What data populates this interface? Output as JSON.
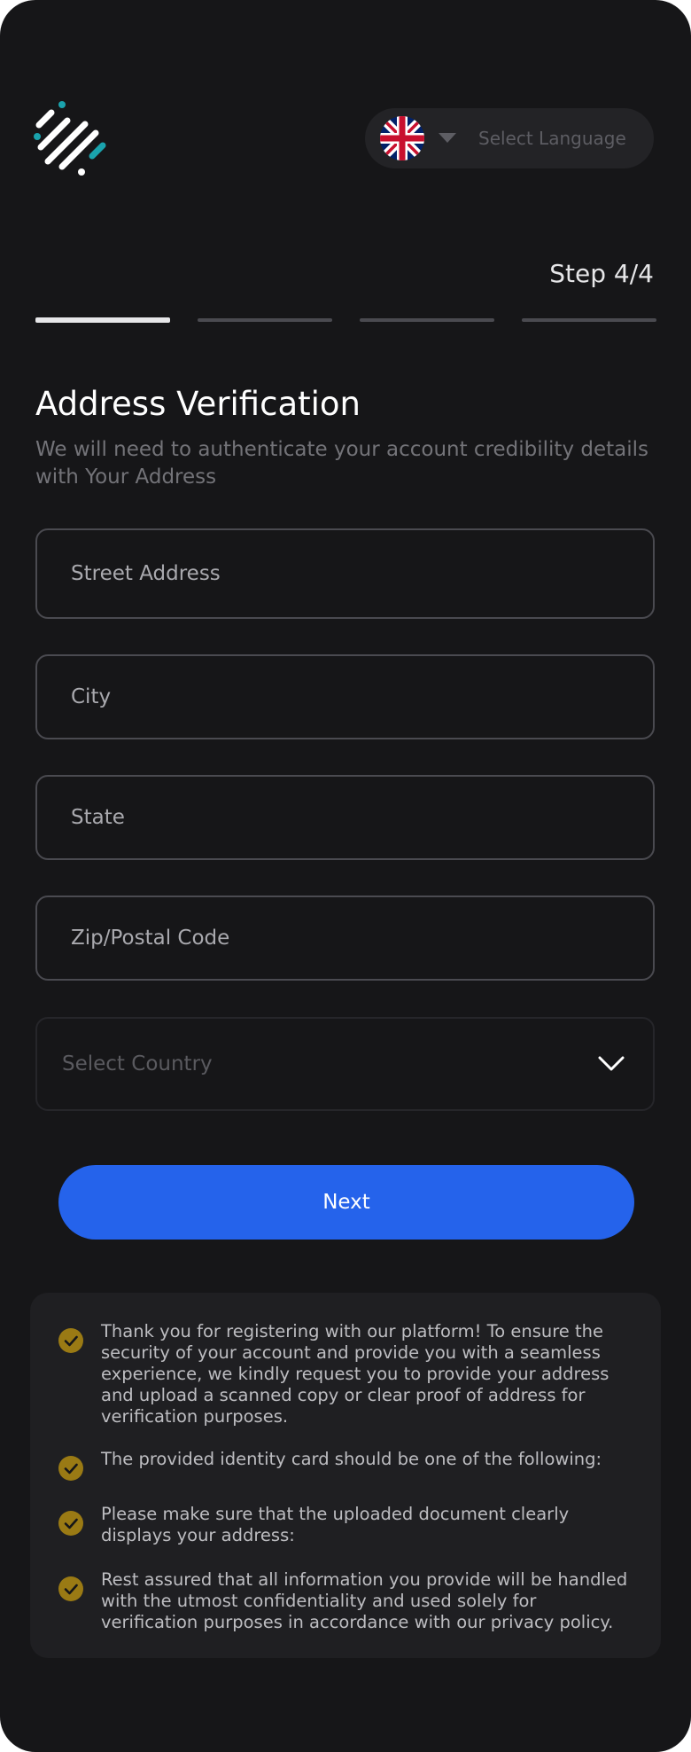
{
  "header": {
    "language_label": "Select Language",
    "flag_icon": "uk-flag-icon"
  },
  "progress": {
    "step_text": "Step 4/4",
    "segments": 4,
    "active_segment": 1
  },
  "form": {
    "title": "Address Verification",
    "subtitle": "We will need to authenticate your account credibility details with Your Address",
    "street_placeholder": "Street Address",
    "city_placeholder": "City",
    "state_placeholder": "State",
    "zip_placeholder": "Zip/Postal Code",
    "country_placeholder": "Select Country",
    "next_label": "Next"
  },
  "info": {
    "items": [
      {
        "text": "Thank you for registering with our platform! To ensure the security of your account and provide you with a seamless experience, we kindly request you to provide your address and upload a scanned copy or clear proof of address for verification purposes."
      },
      {
        "text": "The provided identity card should be one of the following:"
      },
      {
        "text": "Please make sure that the uploaded document clearly displays your address:"
      },
      {
        "text": "Rest assured that all information you provide will be handled with the utmost confidentiality and used solely for verification purposes in accordance with our privacy policy."
      }
    ]
  },
  "colors": {
    "background": "#161618",
    "accent": "#2563eb",
    "check": "#9a7a14"
  }
}
